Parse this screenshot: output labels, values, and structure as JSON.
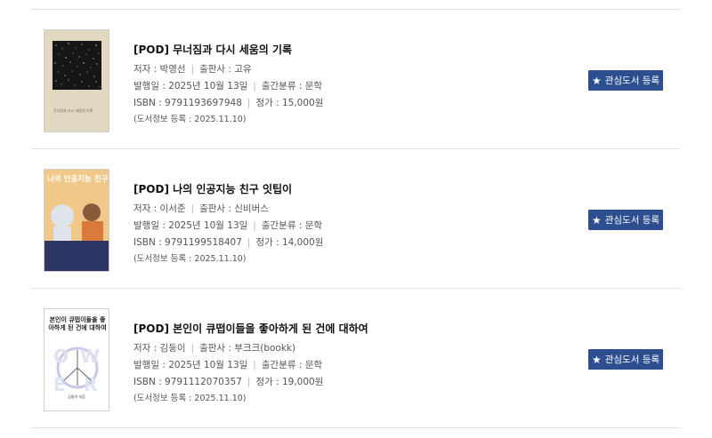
{
  "books": [
    {
      "title": "[POD] 무너짐과 다시 세움의 기록",
      "author": "저자 : 박영선",
      "publisher": "출판사 : 고유",
      "date": "발행일 : 2025년 10월 13일",
      "category": "출간분류 : 문학",
      "isbn": "ISBN : 9791193697948",
      "price": "정가 : 15,000원",
      "registered": "(도서정보 등록 : 2025.11.10)",
      "button": "관심도서 등록",
      "cover_text": "무너짐과 다시 세움의 기록"
    },
    {
      "title": "[POD] 나의 인공지능 친구 잇팁이",
      "author": "저자 : 이서준",
      "publisher": "출판사 : 신비버스",
      "date": "발행일 : 2025년 10월 13일",
      "category": "출간분류 : 문학",
      "isbn": "ISBN : 9791199518407",
      "price": "정가 : 14,000원",
      "registered": "(도서정보 등록 : 2025.11.10)",
      "button": "관심도서 등록",
      "cover_text": "나의 인공지능 친구 잇팁이"
    },
    {
      "title": "[POD] 본인이 큐떱이들을 좋아하게 된 건에 대하여",
      "author": "저자 : 김둥이",
      "publisher": "출판사 : 부크크(bookk)",
      "date": "발행일 : 2025년 10월 13일",
      "category": "출간분류 : 문학",
      "isbn": "ISBN : 9791112070357",
      "price": "정가 : 19,000원",
      "registered": "(도서정보 등록 : 2025.11.10)",
      "button": "관심도서 등록",
      "cover_text": "본인이 큐떱이들을 좋아하게 된 건에 대하여",
      "cover_author": "김둥이 지음"
    }
  ],
  "colors": {
    "button_bg": "#2d4f8f",
    "divider": "#e2e2e2"
  },
  "icons": {
    "button": "star-icon"
  }
}
